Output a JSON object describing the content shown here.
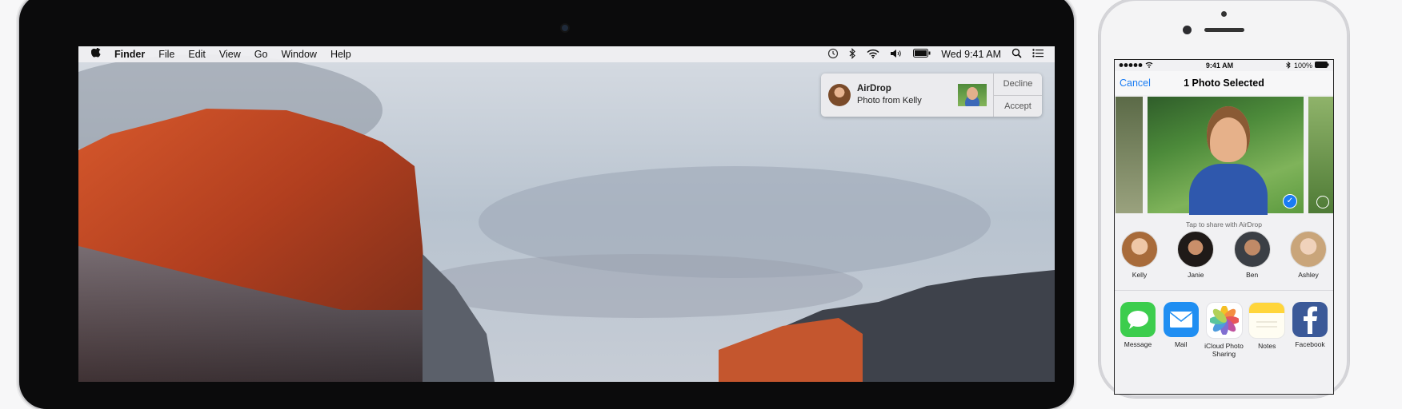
{
  "mac": {
    "menubar": {
      "app_name": "Finder",
      "menus": [
        "File",
        "Edit",
        "View",
        "Go",
        "Window",
        "Help"
      ],
      "clock": "Wed 9:41 AM",
      "status_icons": [
        "time-machine-icon",
        "bluetooth-icon",
        "wifi-icon",
        "volume-icon",
        "battery-icon",
        "spotlight-icon",
        "notification-center-icon"
      ]
    },
    "notification": {
      "title": "AirDrop",
      "subtitle": "Photo from Kelly",
      "decline": "Decline",
      "accept": "Accept"
    }
  },
  "iphone": {
    "status": {
      "time": "9:41 AM",
      "battery": "100%"
    },
    "nav": {
      "cancel": "Cancel",
      "title": "1 Photo Selected"
    },
    "hint": "Tap to share with AirDrop",
    "people": [
      "Kelly",
      "Janie",
      "Ben",
      "Ashley"
    ],
    "apps": [
      {
        "label": "Message",
        "icon": "message-icon",
        "color": "#3ccd4d"
      },
      {
        "label": "Mail",
        "icon": "mail-icon",
        "color": "#1f8ef2"
      },
      {
        "label": "iCloud Photo Sharing",
        "icon": "photos-icon",
        "color": "#ffffff"
      },
      {
        "label": "Notes",
        "icon": "notes-icon",
        "color": "#ffd53a"
      },
      {
        "label": "Facebook",
        "icon": "facebook-icon",
        "color": "#3b5998"
      }
    ]
  }
}
